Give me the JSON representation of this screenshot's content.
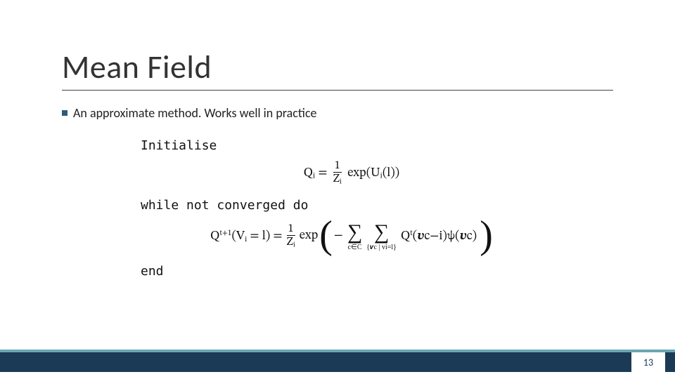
{
  "slide": {
    "title": "Mean Field",
    "bullet1": "An approximate method. Works well in practice",
    "page_number": "13"
  },
  "algo": {
    "initialise": "Initialise",
    "while_line": "while not converged do",
    "end_line": "end"
  },
  "eq1": {
    "lhs_Q": "Q",
    "lhs_i": "i",
    "eq": " = ",
    "frac_num": "1",
    "frac_den_Z": "Z",
    "frac_den_i": "i",
    "exp_text": " exp(",
    "U": "U",
    "Ui": "i",
    "arg": "(l))"
  },
  "eq2": {
    "Q": "Q",
    "sup_t1": "t+1",
    "paren_V": "(V",
    "Vi": "i",
    "eq_l": " = l) = ",
    "frac_num": "1",
    "frac_den_Z": "Z",
    "frac_den_i": "i",
    "exp_text": " exp",
    "minus": "−",
    "sum1_sub": "c∈C",
    "sum2_sub": "{𝒗c | vi=l}",
    "Qt": "Q",
    "sup_t": "t",
    "vc_minus_i": "(𝒗c−i)",
    "psi": "ψ",
    "psi_arg": "(𝒗c)"
  }
}
